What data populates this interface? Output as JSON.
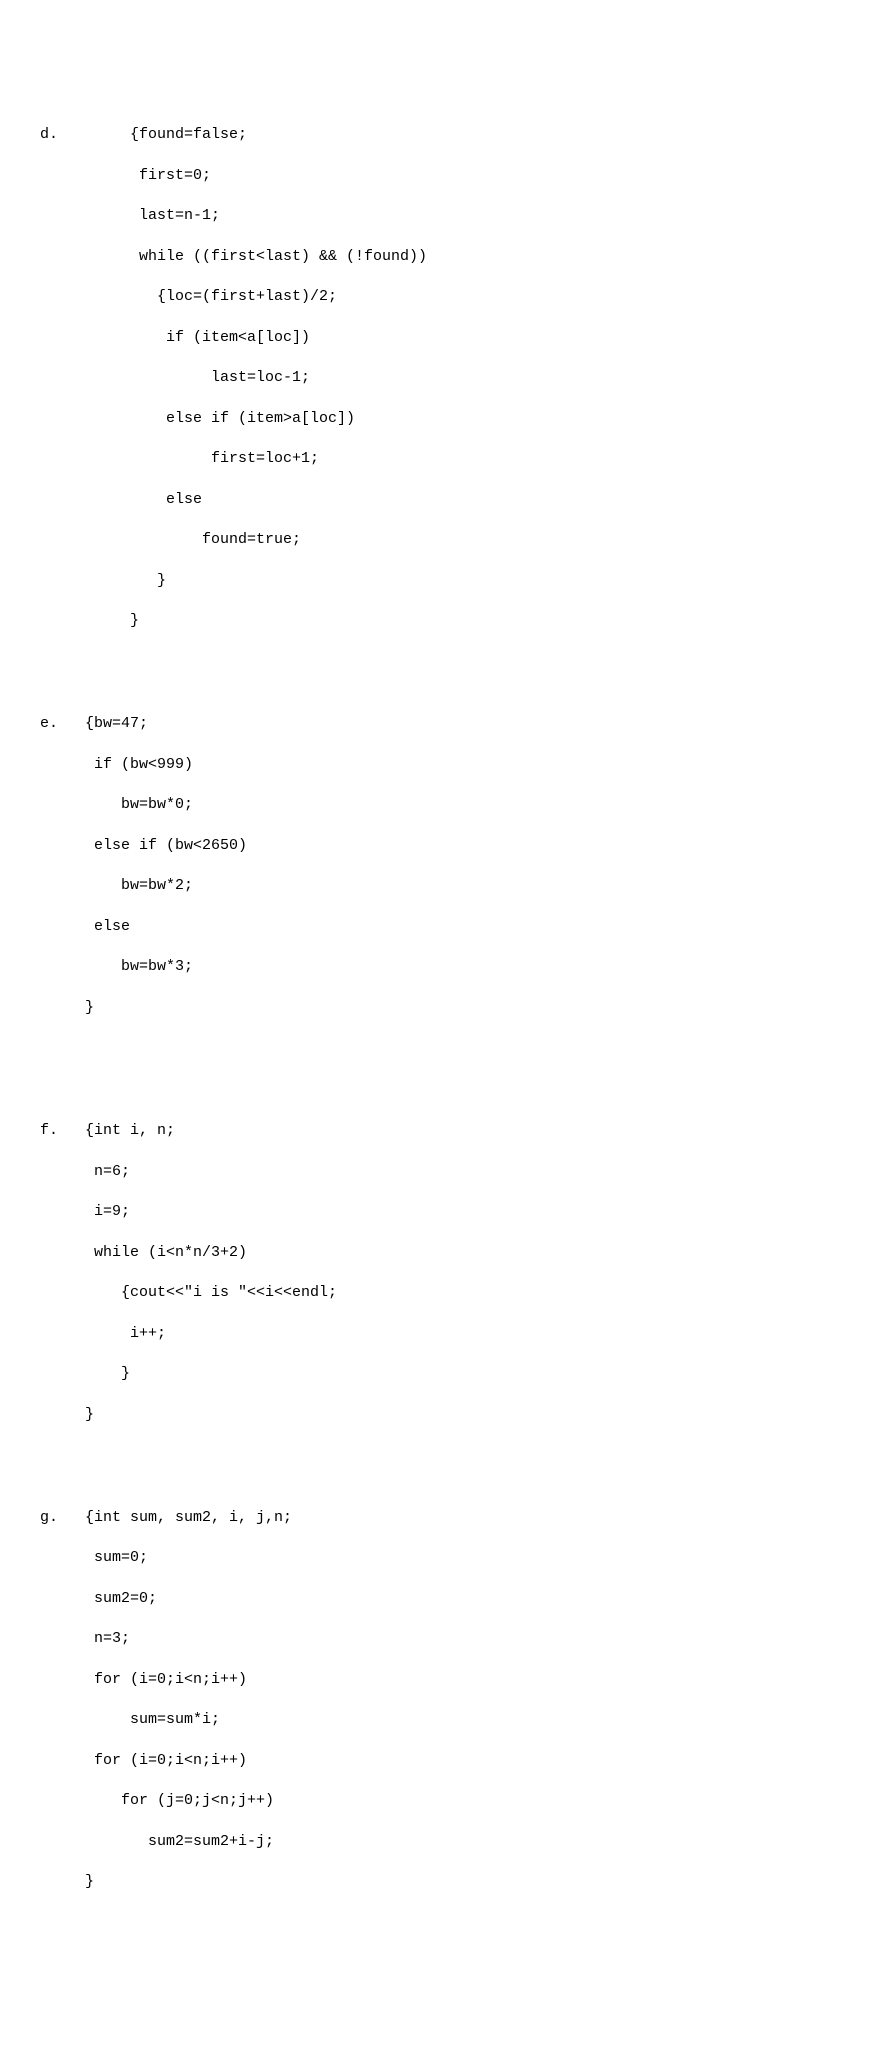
{
  "blocks": {
    "d": {
      "label": "d.",
      "lines": [
        "d.        {found=false;",
        "           first=0;",
        "           last=n-1;",
        "           while ((first<last) && (!found))",
        "             {loc=(first+last)/2;",
        "              if (item<a[loc])",
        "                   last=loc-1;",
        "              else if (item>a[loc])",
        "                   first=loc+1;",
        "              else",
        "                  found=true;",
        "             }",
        "          }"
      ]
    },
    "e": {
      "label": "e.",
      "lines": [
        "e.   {bw=47;",
        "      if (bw<999)",
        "         bw=bw*0;",
        "      else if (bw<2650)",
        "         bw=bw*2;",
        "      else",
        "         bw=bw*3;",
        "     }"
      ]
    },
    "f": {
      "label": "f.",
      "lines": [
        "f.   {int i, n;",
        "      n=6;",
        "      i=9;",
        "      while (i<n*n/3+2)",
        "         {cout<<\"i is \"<<i<<endl;",
        "          i++;",
        "         }",
        "     }"
      ]
    },
    "g": {
      "label": "g.",
      "lines": [
        "g.   {int sum, sum2, i, j,n;",
        "      sum=0;",
        "      sum2=0;",
        "      n=3;",
        "      for (i=0;i<n;i++)",
        "          sum=sum*i;",
        "      for (i=0;i<n;i++)",
        "         for (j=0;j<n;j++)",
        "            sum2=sum2+i-j;",
        "     }"
      ]
    }
  }
}
